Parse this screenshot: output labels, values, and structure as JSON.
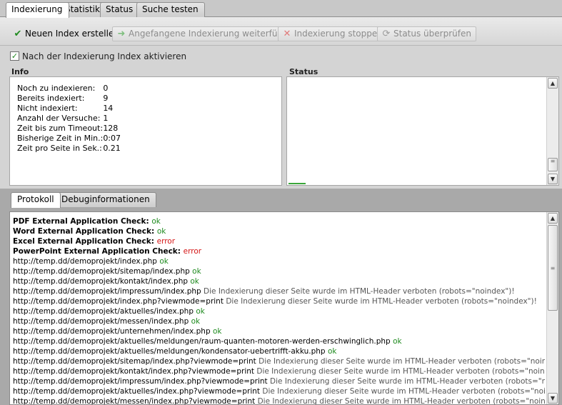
{
  "tabs": [
    "Indexierung",
    "Statistik",
    "Status",
    "Suche testen"
  ],
  "toolbar": {
    "create": "Neuen Index erstellen",
    "continue": "Angefangene Indexierung weiterführen",
    "stop": "Indexierung stoppen",
    "check": "Status überprüfen"
  },
  "activate_checkbox": {
    "label": "Nach der Indexierung Index aktivieren",
    "checked": true
  },
  "info": {
    "heading": "Info",
    "rows": [
      {
        "key": "Noch zu indexieren:",
        "value": "0"
      },
      {
        "key": "Bereits indexiert:",
        "value": "9"
      },
      {
        "key": "Nicht indexiert:",
        "value": "14"
      },
      {
        "key": "Anzahl der Versuche:",
        "value": "1"
      },
      {
        "key": "Zeit bis zum Timeout:",
        "value": "128"
      },
      {
        "key": "Bisherige Zeit in Min.:",
        "value": "0:07"
      },
      {
        "key": "Zeit pro Seite in Sek.:",
        "value": "0.21"
      }
    ]
  },
  "status": {
    "heading": "Status"
  },
  "lower_tabs": [
    "Protokoll",
    "Debuginformationen"
  ],
  "log": [
    {
      "text": "PDF External Application Check:",
      "bold": true,
      "result": "ok",
      "type": "ok"
    },
    {
      "text": "Word External Application Check:",
      "bold": true,
      "result": "ok",
      "type": "ok"
    },
    {
      "text": "Excel External Application Check:",
      "bold": true,
      "result": "error",
      "type": "err"
    },
    {
      "text": "PowerPoint External Application Check:",
      "bold": true,
      "result": "error",
      "type": "err"
    },
    {
      "text": "http://temp.dd/demoprojekt/index.php",
      "result": "ok",
      "type": "ok"
    },
    {
      "text": "http://temp.dd/demoprojekt/sitemap/index.php",
      "result": "ok",
      "type": "ok"
    },
    {
      "text": "http://temp.dd/demoprojekt/kontakt/index.php",
      "result": "ok",
      "type": "ok"
    },
    {
      "text": "http://temp.dd/demoprojekt/impressum/index.php",
      "result": "Die Indexierung dieser Seite wurde im HTML-Header verboten (robots=\"noindex\")!",
      "type": "msg"
    },
    {
      "text": "http://temp.dd/demoprojekt/index.php?viewmode=print",
      "result": "Die Indexierung dieser Seite wurde im HTML-Header verboten (robots=\"noindex\")!",
      "type": "msg"
    },
    {
      "text": "http://temp.dd/demoprojekt/aktuelles/index.php",
      "result": "ok",
      "type": "ok"
    },
    {
      "text": "http://temp.dd/demoprojekt/messen/index.php",
      "result": "ok",
      "type": "ok"
    },
    {
      "text": "http://temp.dd/demoprojekt/unternehmen/index.php",
      "result": "ok",
      "type": "ok"
    },
    {
      "text": "http://temp.dd/demoprojekt/aktuelles/meldungen/raum-quanten-motoren-werden-erschwinglich.php",
      "result": "ok",
      "type": "ok"
    },
    {
      "text": "http://temp.dd/demoprojekt/aktuelles/meldungen/kondensator-uebertrifft-akku.php",
      "result": "ok",
      "type": "ok"
    },
    {
      "text": "http://temp.dd/demoprojekt/sitemap/index.php?viewmode=print",
      "result": "Die Indexierung dieser Seite wurde im HTML-Header verboten (robots=\"noindex\")!",
      "type": "msg"
    },
    {
      "text": "http://temp.dd/demoprojekt/kontakt/index.php?viewmode=print",
      "result": "Die Indexierung dieser Seite wurde im HTML-Header verboten (robots=\"noindex\")!",
      "type": "msg"
    },
    {
      "text": "http://temp.dd/demoprojekt/impressum/index.php?viewmode=print",
      "result": "Die Indexierung dieser Seite wurde im HTML-Header verboten (robots=\"noindex\")!",
      "type": "msg"
    },
    {
      "text": "http://temp.dd/demoprojekt/aktuelles/index.php?viewmode=print",
      "result": "Die Indexierung dieser Seite wurde im HTML-Header verboten (robots=\"noindex\")!",
      "type": "msg"
    },
    {
      "text": "http://temp.dd/demoprojekt/messen/index.php?viewmode=print",
      "result": "Die Indexierung dieser Seite wurde im HTML-Header verboten (robots=\"noindex\")!",
      "type": "msg"
    }
  ]
}
